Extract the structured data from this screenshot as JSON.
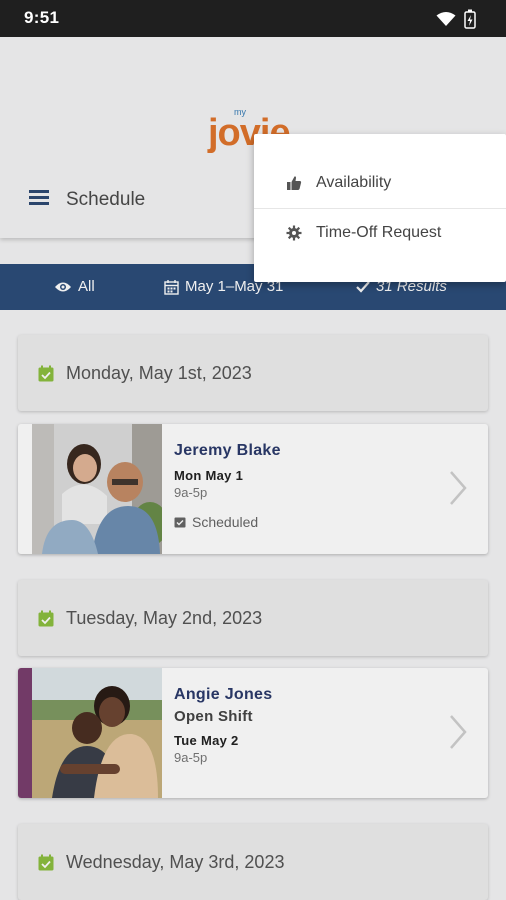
{
  "status_bar": {
    "time": "9:51"
  },
  "logo": {
    "small": "my",
    "word": "jovie"
  },
  "header": {
    "title": "Schedule"
  },
  "menu": {
    "items": [
      {
        "label": "Availability",
        "icon": "thumbs-up-icon"
      },
      {
        "label": "Time-Off Request",
        "icon": "gear-icon"
      }
    ]
  },
  "filter": {
    "view": "All",
    "date_range": "May 1–May 31",
    "results": "31 Results"
  },
  "days": [
    {
      "label": "Monday, May 1st, 2023"
    },
    {
      "label": "Tuesday, May 2nd, 2023"
    },
    {
      "label": "Wednesday, May 3rd, 2023"
    }
  ],
  "shifts": [
    {
      "name": "Jeremy Blake",
      "subtitle": "",
      "date": "Mon May 1",
      "hours": "9a-5p",
      "status": "Scheduled"
    },
    {
      "name": "Angie Jones",
      "subtitle": "Open Shift",
      "date": "Tue May 2",
      "hours": "9a-5p",
      "status": ""
    }
  ],
  "colors": {
    "brand_orange": "#e0742c",
    "filter_bar": "#2c4d7a",
    "calendar_icon": "#8cbf3f",
    "open_shift_accent": "#7a3e6e",
    "name_text": "#2b3a6b"
  }
}
